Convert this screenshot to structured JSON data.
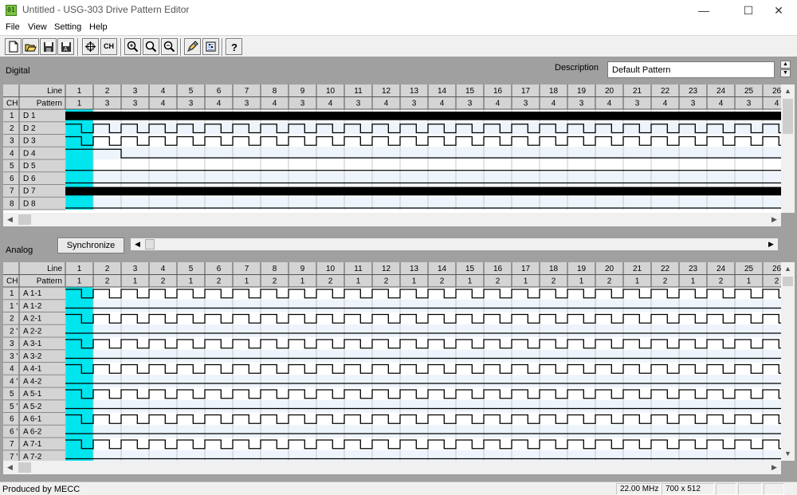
{
  "window": {
    "title": "Untitled - USG-303 Drive Pattern Editor",
    "icon_text": "01"
  },
  "menu": [
    "File",
    "View",
    "Setting",
    "Help"
  ],
  "toolbar": [
    {
      "icon": "new-file-icon"
    },
    {
      "icon": "open-folder-icon"
    },
    {
      "icon": "save-icon"
    },
    {
      "icon": "save-as-icon"
    },
    {
      "icon": "move-cursor-icon"
    },
    {
      "icon": "channel-icon",
      "text": "CH"
    },
    {
      "icon": "zoom-in-icon"
    },
    {
      "icon": "zoom-icon"
    },
    {
      "icon": "zoom-out-icon"
    },
    {
      "icon": "edit-pencil-icon"
    },
    {
      "icon": "settings-icon"
    },
    {
      "icon": "help-icon"
    }
  ],
  "digital": {
    "label": "Digital",
    "description_label": "Description",
    "description_value": "Default Pattern",
    "line_header": "Line",
    "pattern_header": "Pattern",
    "ch_header": "CH",
    "line_numbers": [
      1,
      2,
      3,
      4,
      5,
      6,
      7,
      8,
      9,
      10,
      11,
      12,
      13,
      14,
      15,
      16,
      17,
      18,
      19,
      20,
      21,
      22,
      23,
      24,
      25,
      26
    ],
    "patterns": [
      1,
      3,
      3,
      4,
      3,
      4,
      3,
      4,
      3,
      4,
      3,
      4,
      3,
      4,
      3,
      4,
      3,
      4,
      3,
      4,
      3,
      4,
      3,
      4,
      3,
      4
    ],
    "channels": [
      {
        "ch": "1",
        "name": "D 1",
        "signal": "high"
      },
      {
        "ch": "2",
        "name": "D 2",
        "signal": "clock"
      },
      {
        "ch": "3",
        "name": "D 3",
        "signal": "clock"
      },
      {
        "ch": "4",
        "name": "D 4",
        "signal": "high-then-low"
      },
      {
        "ch": "5",
        "name": "D 5",
        "signal": "low"
      },
      {
        "ch": "6",
        "name": "D 6",
        "signal": "low"
      },
      {
        "ch": "7",
        "name": "D 7",
        "signal": "high"
      },
      {
        "ch": "8",
        "name": "D 8",
        "signal": "low"
      }
    ]
  },
  "analog": {
    "label": "Analog",
    "sync_button": "Synchronize",
    "line_header": "Line",
    "pattern_header": "Pattern",
    "ch_header": "CH",
    "line_numbers": [
      1,
      2,
      3,
      4,
      5,
      6,
      7,
      8,
      9,
      10,
      11,
      12,
      13,
      14,
      15,
      16,
      17,
      18,
      19,
      20,
      21,
      22,
      23,
      24,
      25,
      26
    ],
    "patterns": [
      1,
      2,
      1,
      2,
      1,
      2,
      1,
      2,
      1,
      2,
      1,
      2,
      1,
      2,
      1,
      2,
      1,
      2,
      1,
      2,
      1,
      2,
      1,
      2,
      1,
      2
    ],
    "channels": [
      {
        "ch": "1",
        "name": "A 1-1",
        "signal": "clock"
      },
      {
        "ch": "1 '",
        "name": "A 1-2",
        "signal": "low"
      },
      {
        "ch": "2",
        "name": "A 2-1",
        "signal": "clock"
      },
      {
        "ch": "2 '",
        "name": "A 2-2",
        "signal": "low"
      },
      {
        "ch": "3",
        "name": "A 3-1",
        "signal": "clock"
      },
      {
        "ch": "3 '",
        "name": "A 3-2",
        "signal": "low"
      },
      {
        "ch": "4",
        "name": "A 4-1",
        "signal": "clock"
      },
      {
        "ch": "4 '",
        "name": "A 4-2",
        "signal": "low"
      },
      {
        "ch": "5",
        "name": "A 5-1",
        "signal": "clock"
      },
      {
        "ch": "5 '",
        "name": "A 5-2",
        "signal": "low"
      },
      {
        "ch": "6",
        "name": "A 6-1",
        "signal": "clock"
      },
      {
        "ch": "6 '",
        "name": "A 6-2",
        "signal": "low"
      },
      {
        "ch": "7",
        "name": "A 7-1",
        "signal": "clock"
      },
      {
        "ch": "7 '",
        "name": "A 7-2",
        "signal": "low"
      }
    ]
  },
  "statusbar": {
    "left": "Produced by MECC",
    "frequency": "22.00 MHz",
    "size": "700 x 512"
  },
  "colors": {
    "selected_column": "#00e5ee",
    "header_bg": "#d4d4d4",
    "row_alt": "#eef4fb",
    "background": "#a0a0a0"
  }
}
